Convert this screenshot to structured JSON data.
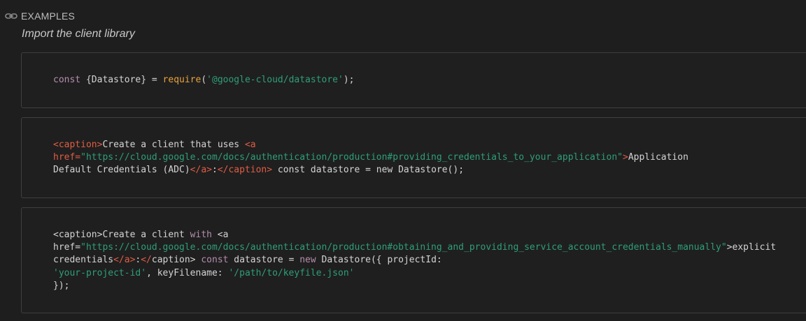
{
  "header": {
    "icon": "link-icon",
    "title": "EXAMPLES"
  },
  "subtitle": "Import the client library",
  "blocks": [
    {
      "lines": [
        [
          {
            "t": "const",
            "c": "kw"
          },
          {
            "t": " {Datastore} = ",
            "c": "plain"
          },
          {
            "t": "require",
            "c": "fn"
          },
          {
            "t": "(",
            "c": "plain"
          },
          {
            "t": "'@google-cloud/datastore'",
            "c": "str"
          },
          {
            "t": ");",
            "c": "plain"
          }
        ]
      ]
    },
    {
      "lines": [
        [
          {
            "t": "<caption>",
            "c": "tag"
          },
          {
            "t": "Create a client that uses ",
            "c": "plain"
          },
          {
            "t": "<a",
            "c": "tag"
          }
        ],
        [
          {
            "t": "href=",
            "c": "tag"
          },
          {
            "t": "\"https://cloud.google.com/docs/authentication/production#providing_credentials_to_your_application\"",
            "c": "str"
          },
          {
            "t": ">",
            "c": "tag"
          },
          {
            "t": "Application",
            "c": "plain"
          }
        ],
        [
          {
            "t": "Default Credentials (ADC)",
            "c": "plain"
          },
          {
            "t": "</a>",
            "c": "tag"
          },
          {
            "t": ":",
            "c": "plain"
          },
          {
            "t": "</caption>",
            "c": "tag"
          },
          {
            "t": " const datastore = new Datastore();",
            "c": "plain"
          }
        ]
      ]
    },
    {
      "lines": [
        [
          {
            "t": "<caption>Create a client ",
            "c": "plain"
          },
          {
            "t": "with",
            "c": "kw"
          },
          {
            "t": " <a",
            "c": "plain"
          }
        ],
        [
          {
            "t": "href=",
            "c": "plain"
          },
          {
            "t": "\"https://cloud.google.com/docs/authentication/production#obtaining_and_providing_service_account_credentials_manually\"",
            "c": "str"
          },
          {
            "t": ">explicit",
            "c": "plain"
          }
        ],
        [
          {
            "t": "credentials",
            "c": "plain"
          },
          {
            "t": "</a>",
            "c": "tag"
          },
          {
            "t": ":",
            "c": "plain"
          },
          {
            "t": "</",
            "c": "tag"
          },
          {
            "t": "caption> ",
            "c": "plain"
          },
          {
            "t": "const",
            "c": "kw"
          },
          {
            "t": " datastore = ",
            "c": "plain"
          },
          {
            "t": "new",
            "c": "kw"
          },
          {
            "t": " Datastore({ projectId:",
            "c": "plain"
          }
        ],
        [
          {
            "t": "'your-project-id'",
            "c": "str"
          },
          {
            "t": ", keyFilename: ",
            "c": "plain"
          },
          {
            "t": "'/path/to/keyfile.json'",
            "c": "str"
          }
        ],
        [
          {
            "t": "});",
            "c": "plain"
          }
        ]
      ]
    }
  ]
}
